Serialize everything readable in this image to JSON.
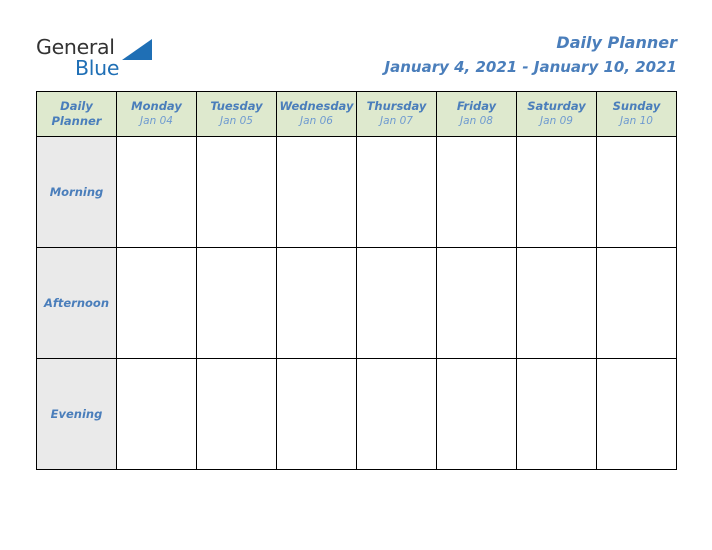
{
  "logo": {
    "word_dark": "General",
    "word_blue": "Blue",
    "triangle_icon": "triangle-icon",
    "dark_color": "#333333",
    "blue_color": "#1F6FB5"
  },
  "header": {
    "title": "Daily Planner",
    "date_range": "January 4, 2021 - January 10, 2021",
    "title_color": "#4A7EBB"
  },
  "table": {
    "corner": {
      "line1": "Daily",
      "line2": "Planner"
    },
    "header_bg": "#DEE9CE",
    "row_label_bg": "#EAEAEA",
    "border_color": "#000000",
    "columns": [
      {
        "day": "Monday",
        "date": "Jan 04"
      },
      {
        "day": "Tuesday",
        "date": "Jan 05"
      },
      {
        "day": "Wednesday",
        "date": "Jan 06"
      },
      {
        "day": "Thursday",
        "date": "Jan 07"
      },
      {
        "day": "Friday",
        "date": "Jan 08"
      },
      {
        "day": "Saturday",
        "date": "Jan 09"
      },
      {
        "day": "Sunday",
        "date": "Jan 10"
      }
    ],
    "rows": [
      {
        "label": "Morning",
        "cells": [
          "",
          "",
          "",
          "",
          "",
          "",
          ""
        ]
      },
      {
        "label": "Afternoon",
        "cells": [
          "",
          "",
          "",
          "",
          "",
          "",
          ""
        ]
      },
      {
        "label": "Evening",
        "cells": [
          "",
          "",
          "",
          "",
          "",
          "",
          ""
        ]
      }
    ]
  }
}
